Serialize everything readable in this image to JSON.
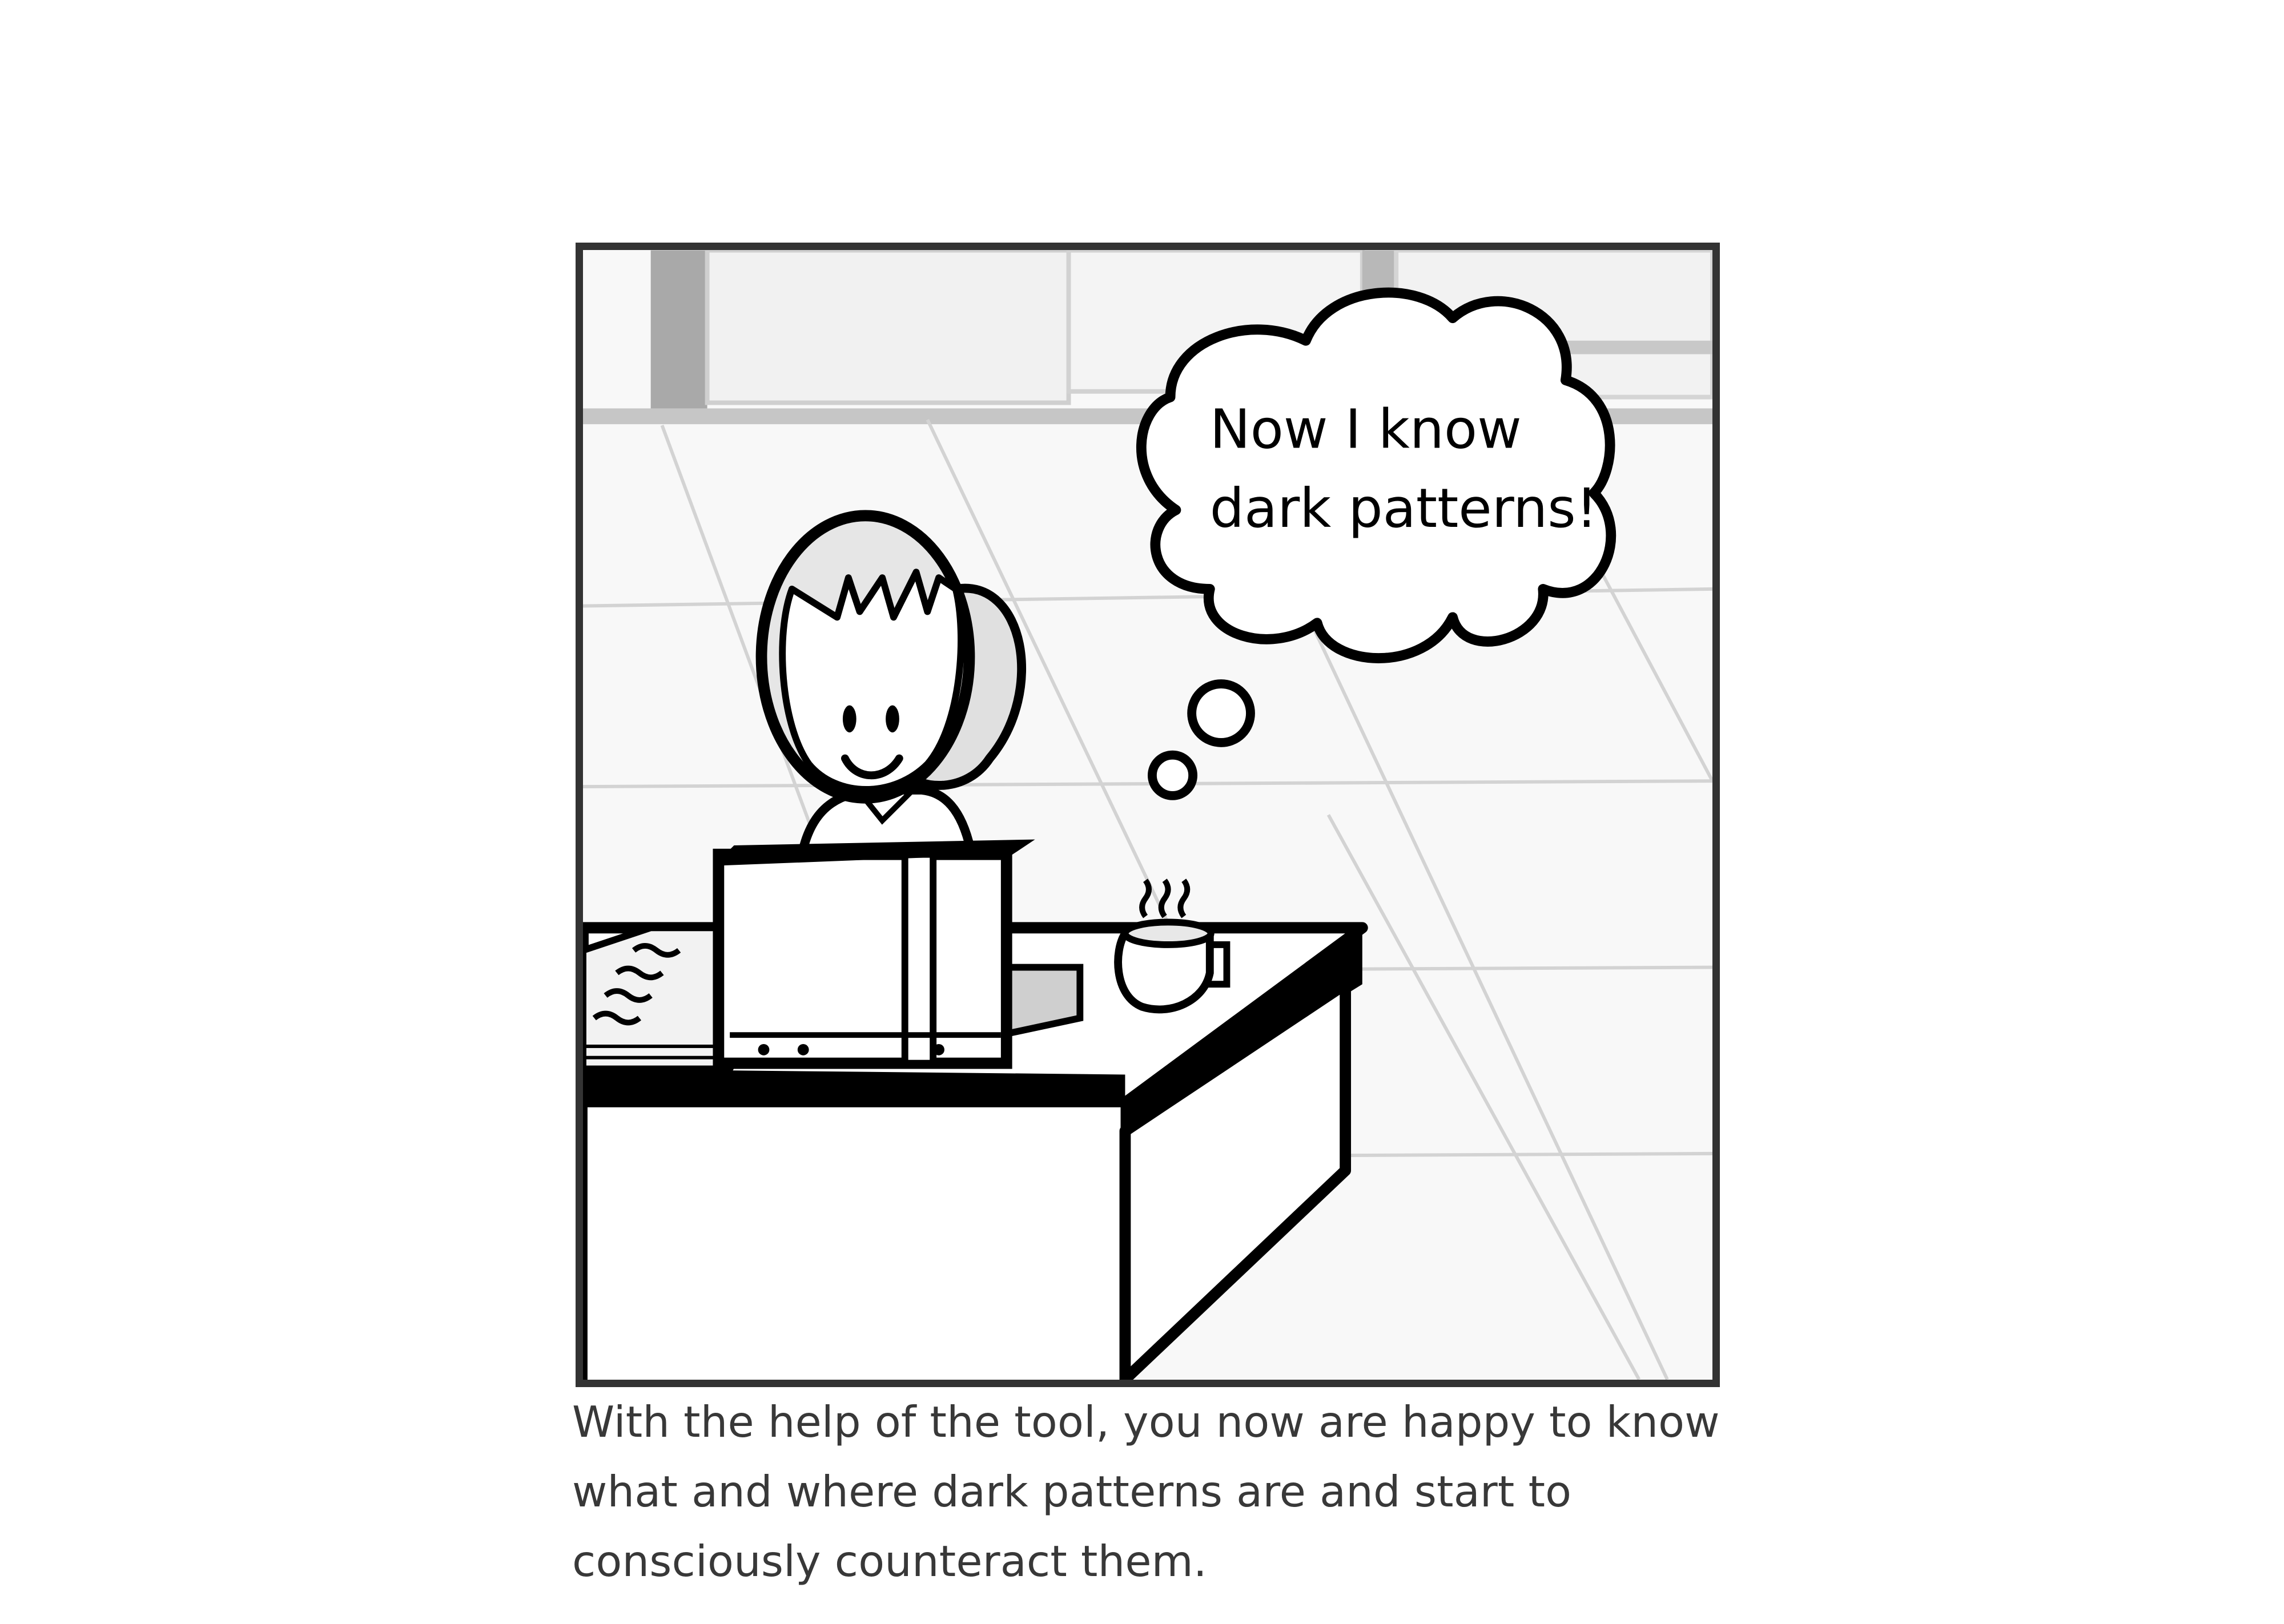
{
  "illustration": {
    "thought_bubble": {
      "line1": "Now I know",
      "line2": "dark patterns!"
    }
  },
  "caption": {
    "text": "With the help of the tool, you now are happy to know what and where dark patterns are and start to consciously counteract them."
  }
}
